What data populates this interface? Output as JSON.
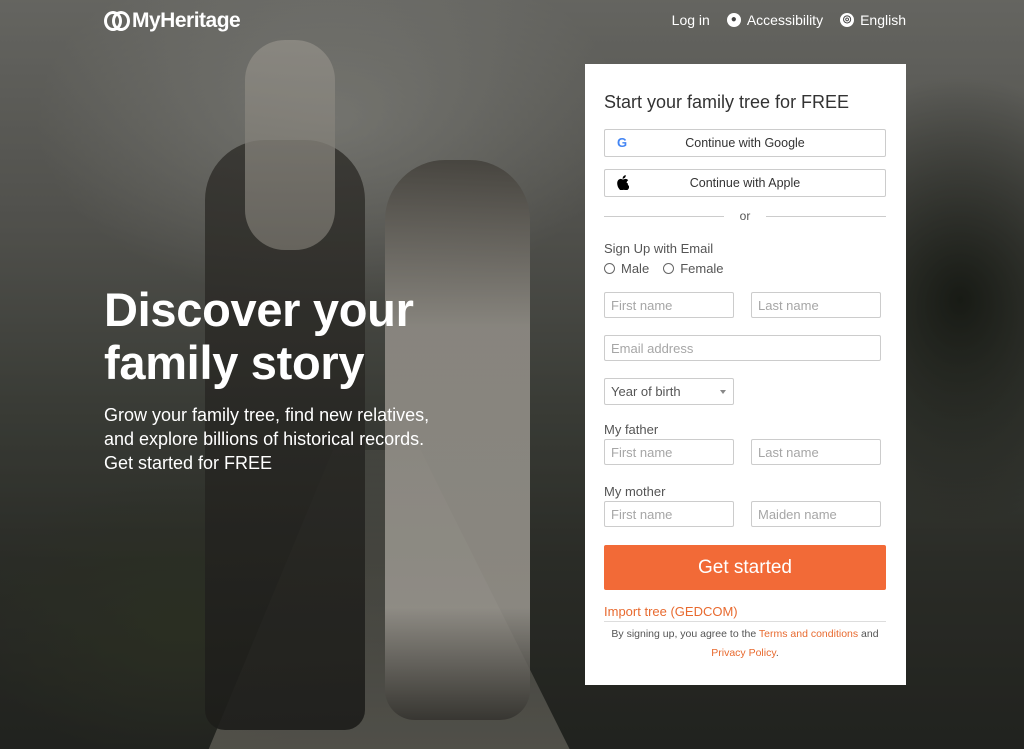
{
  "header": {
    "logo_text": "MyHeritage",
    "nav": {
      "login": "Log in",
      "accessibility": "Accessibility",
      "language": "English"
    }
  },
  "hero": {
    "title_line1": "Discover your",
    "title_line2": "family story",
    "subtitle_line1": "Grow your family tree, find new relatives,",
    "subtitle_line2": "and explore billions of historical records.",
    "subtitle_line3": "Get started for FREE"
  },
  "signup": {
    "title": "Start your family tree for FREE",
    "google_label": "Continue with Google",
    "apple_label": "Continue with Apple",
    "or_label": "or",
    "email_section_label": "Sign Up with Email",
    "gender_options": [
      "Male",
      "Female"
    ],
    "first_name_placeholder": "First name",
    "last_name_placeholder": "Last name",
    "email_placeholder": "Email address",
    "year_of_birth_label": "Year of birth",
    "father_label": "My father",
    "father_first_placeholder": "First name",
    "father_last_placeholder": "Last name",
    "mother_label": "My mother",
    "mother_first_placeholder": "First name",
    "mother_maiden_placeholder": "Maiden name",
    "cta_label": "Get started",
    "import_label": "Import tree (GEDCOM)",
    "legal_prefix": "By signing up, you agree to the",
    "terms_link": "Terms and conditions",
    "legal_and": "and",
    "privacy_link": "Privacy Policy",
    "legal_suffix": "."
  },
  "colors": {
    "accent": "#f26a37",
    "link": "#e86a2f"
  }
}
